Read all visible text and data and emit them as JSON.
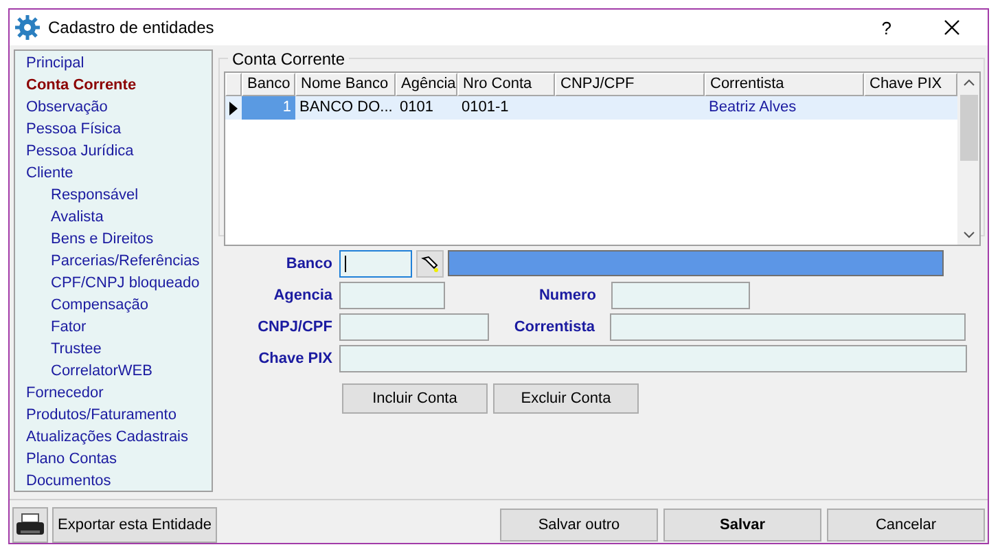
{
  "window": {
    "title": "Cadastro de entidades",
    "help": "?"
  },
  "sidebar": {
    "items": [
      {
        "label": "Principal",
        "selected": false
      },
      {
        "label": "Conta Corrente",
        "selected": true
      },
      {
        "label": "Observação",
        "selected": false
      },
      {
        "label": "Pessoa Física",
        "selected": false
      },
      {
        "label": "Pessoa Jurídica",
        "selected": false
      },
      {
        "label": "Cliente",
        "selected": false,
        "children": [
          {
            "label": "Responsável",
            "selected": false
          },
          {
            "label": "Avalista",
            "selected": false
          },
          {
            "label": "Bens e Direitos",
            "selected": false
          },
          {
            "label": "Parcerias/Referências",
            "selected": false
          },
          {
            "label": "CPF/CNPJ bloqueado",
            "selected": false
          },
          {
            "label": "Compensação",
            "selected": false
          },
          {
            "label": "Fator",
            "selected": false
          },
          {
            "label": "Trustee",
            "selected": false
          },
          {
            "label": "CorrelatorWEB",
            "selected": false
          }
        ]
      },
      {
        "label": "Fornecedor",
        "selected": false
      },
      {
        "label": "Produtos/Faturamento",
        "selected": false
      },
      {
        "label": "Atualizações Cadastrais",
        "selected": false
      },
      {
        "label": "Plano Contas",
        "selected": false
      },
      {
        "label": "Documentos",
        "selected": false
      }
    ]
  },
  "group": {
    "title": "Conta Corrente",
    "table": {
      "columns": [
        "Banco",
        "Nome Banco",
        "Agência",
        "Nro Conta",
        "CNPJ/CPF",
        "Correntista",
        "Chave PIX"
      ],
      "rows": [
        {
          "selected": true,
          "cells": [
            "1",
            "BANCO DO...",
            "0101",
            "0101-1",
            "",
            "Beatriz Alves",
            ""
          ]
        }
      ]
    }
  },
  "form": {
    "fields": [
      {
        "label": "Banco",
        "focused": true
      },
      {
        "label": "Agencia",
        "focused": false
      },
      {
        "label": "Numero",
        "focused": false
      },
      {
        "label": "CNPJ/CPF",
        "focused": false
      },
      {
        "label": "Correntista",
        "focused": false
      },
      {
        "label": "Chave PIX",
        "focused": false
      }
    ],
    "buttons": [
      "Incluir Conta",
      "Excluir Conta"
    ]
  },
  "footer": {
    "export_button": "Exportar esta Entidade",
    "buttons": [
      {
        "label": "Salvar outro",
        "default": false
      },
      {
        "label": "Salvar",
        "default": true
      },
      {
        "label": "Cancelar",
        "default": false
      }
    ]
  }
}
